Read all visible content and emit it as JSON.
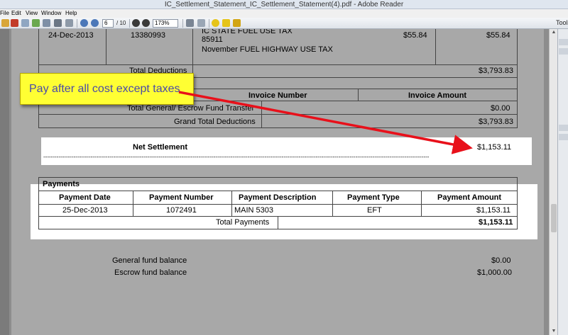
{
  "window": {
    "title": "IC_Settlement_Statement_IC_Settlement_Statement(4).pdf - Adobe Reader"
  },
  "menu": [
    "File",
    "Edit",
    "View",
    "Window",
    "Help"
  ],
  "toolbar": {
    "page_current": "6",
    "page_total": "/ 10",
    "zoom": "173%",
    "tools_label": "Tools"
  },
  "statement": {
    "fuel_row": {
      "date": "24-Dec-2013",
      "number": "13380993",
      "desc_1": "IC STATE FUEL USE TAX",
      "desc_2": "85911",
      "desc_3": "November FUEL HIGHWAY USE TAX",
      "amount": "$55.84",
      "total": "$55.84"
    },
    "total_deductions_label": "Total Deductions",
    "total_deductions_value": "$3,793.83",
    "invoice_header_number": "Invoice Number",
    "invoice_header_amount": "Invoice Amount",
    "general_escrow_label": "Total General/ Escrow Fund Transfer",
    "general_escrow_value": "$0.00",
    "grand_total_label": "Grand Total Deductions",
    "grand_total_value": "$3,793.83",
    "net_settlement_label": "Net Settlement",
    "net_settlement_value": "$1,153.11",
    "dashes": "------------------------------------------------------------------------------------------------------------------------------------------------------------------------------------------------------------"
  },
  "payments": {
    "section_title": "Payments",
    "headers": [
      "Payment  Date",
      "Payment  Number",
      "Payment Description",
      "Payment Type",
      "Payment Amount"
    ],
    "row": [
      "25-Dec-2013",
      "1072491",
      "MAIN 5303",
      "EFT",
      "$1,153.11"
    ],
    "total_label": "Total Payments",
    "total_value": "$1,153.11"
  },
  "balances": {
    "general_label": "General fund balance",
    "general_value": "$0.00",
    "escrow_label": "Escrow fund balance",
    "escrow_value": "$1,000.00"
  },
  "callout": {
    "text": "Pay after all cost except taxes"
  },
  "colors": {
    "callout_bg": "#ffff33",
    "callout_text": "#4a4aa8",
    "arrow": "#e8101a",
    "page_bg": "#a8a8a8"
  }
}
